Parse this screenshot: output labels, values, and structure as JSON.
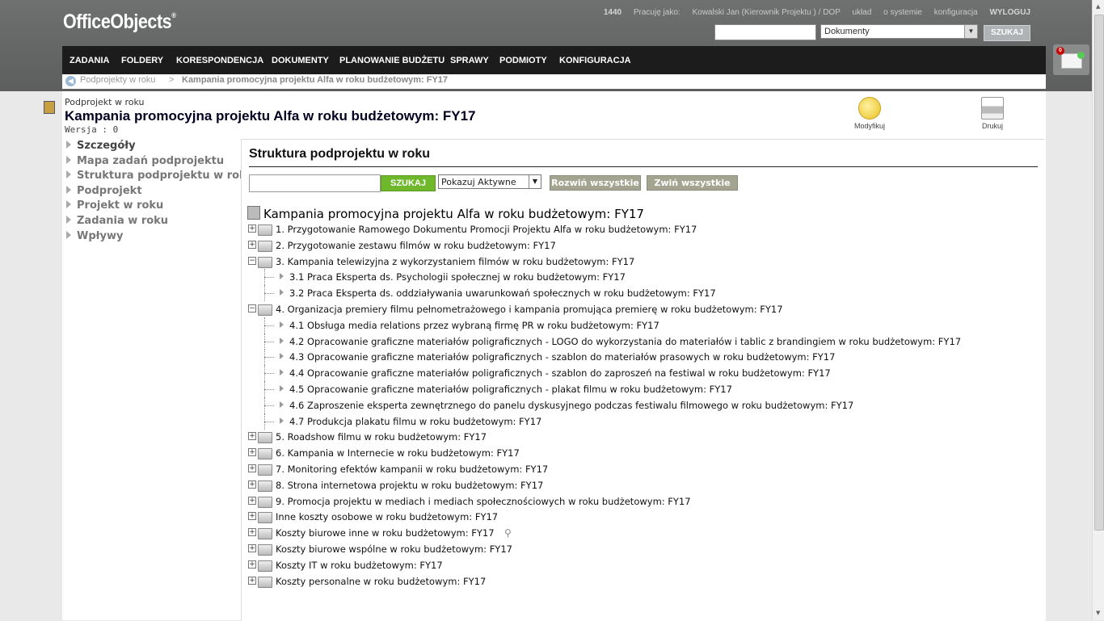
{
  "brand": {
    "name": "OfficeObjects",
    "mark": "®"
  },
  "userbar": {
    "id": "1440",
    "working_as_label": "Pracuję jako:",
    "user": "Kowalski Jan (Kierownik Projektu ) / DOP",
    "layout": "układ",
    "about": "o systemie",
    "config": "konfiguracja",
    "logout": "WYLOGUJ"
  },
  "topsearch": {
    "value": "",
    "scope": "Dokumenty",
    "button": "SZUKAJ"
  },
  "nav": [
    "ZADANIA",
    "FOLDERY",
    "KORESPONDENCJA",
    "DOKUMENTY",
    "PLANOWANIE BUDŻETU",
    "SPRAWY",
    "PODMIOTY",
    "KONFIGURACJA"
  ],
  "breadcrumb": {
    "parent": "Podprojekty w roku",
    "separator": ">",
    "current": "Kampania promocyjna projektu Alfa w roku budżetowym: FY17"
  },
  "mail": {
    "count": "0"
  },
  "page": {
    "type": "Podprojekt w roku",
    "title": "Kampania promocyjna projektu Alfa w roku budżetowym: FY17",
    "version": "Wersja : 0"
  },
  "actions": {
    "edit": "Modyfikuj",
    "print": "Drukuj"
  },
  "sidebar": [
    "Szczegóły",
    "Mapa zadań podprojektu",
    "Struktura podprojektu w roku",
    "Podprojekt",
    "Projekt w roku",
    "Zadania w roku",
    "Wpływy"
  ],
  "panel": {
    "title": "Struktura podprojektu w roku",
    "search_value": "",
    "search_button": "SZUKAJ",
    "filter": "Pokazuj Aktywne",
    "expand_all": "Rozwiń wszystkie",
    "collapse_all": "Zwiń wszystkie",
    "root": "Kampania promocyjna projektu Alfa w roku budżetowym: FY17",
    "rows": [
      {
        "level": 1,
        "label": "1. Przygotowanie Ramowego Dokumentu Promocji Projektu Alfa w roku budżetowym: FY17",
        "pm": "+"
      },
      {
        "level": 1,
        "label": "2. Przygotowanie zestawu filmów w roku budżetowym: FY17",
        "pm": "+"
      },
      {
        "level": 1,
        "label": "3. Kampania telewizyjna z wykorzystaniem filmów w roku budżetowym: FY17",
        "pm": "−"
      },
      {
        "level": 2,
        "label": "3.1 Praca Eksperta ds. Psychologii społecznej w roku budżetowym: FY17"
      },
      {
        "level": 2,
        "label": "3.2 Praca Eksperta ds. oddziaływania uwarunkowań społecznych w roku budżetowym: FY17"
      },
      {
        "level": 1,
        "label": "4. Organizacja premiery filmu pełnometrażowego i kampania promująca premierę w roku budżetowym: FY17",
        "pm": "−"
      },
      {
        "level": 2,
        "label": "4.1 Obsługa media relations przez wybraną firmę PR w roku budżetowym: FY17"
      },
      {
        "level": 2,
        "label": "4.2 Opracowanie graficzne materiałów poligraficznych - LOGO do wykorzystania do materiałów i tablic z brandingiem w roku budżetowym: FY17"
      },
      {
        "level": 2,
        "label": "4.3 Opracowanie graficzne materiałów poligraficznych - szablon do materiałów prasowych w roku budżetowym: FY17"
      },
      {
        "level": 2,
        "label": "4.4 Opracowanie graficzne materiałów poligraficznych - szablon do zaproszeń na festiwal w roku budżetowym: FY17"
      },
      {
        "level": 2,
        "label": "4.5 Opracowanie graficzne materiałów poligraficznych - plakat filmu w roku budżetowym: FY17"
      },
      {
        "level": 2,
        "label": "4.6 Zaproszenie eksperta zewnętrznego do panelu dyskusyjnego podczas festiwalu filmowego w roku budżetowym: FY17"
      },
      {
        "level": 2,
        "label": "4.7 Produkcja plakatu filmu w roku budżetowym: FY17"
      },
      {
        "level": 1,
        "label": "5. Roadshow filmu w roku budżetowym: FY17",
        "pm": "+"
      },
      {
        "level": 1,
        "label": "6. Kampania w Internecie w roku budżetowym: FY17",
        "pm": "+"
      },
      {
        "level": 1,
        "label": "7. Monitoring efektów kampanii w roku budżetowym: FY17",
        "pm": "+"
      },
      {
        "level": 1,
        "label": "8. Strona internetowa projektu w roku budżetowym: FY17",
        "pm": "+"
      },
      {
        "level": 1,
        "label": "9. Promocja projektu w mediach i mediach społecznościowych w roku budżetowym: FY17",
        "pm": "+"
      },
      {
        "level": 1,
        "label": "Inne koszty osobowe w roku budżetowym: FY17",
        "pm": "+"
      },
      {
        "level": 1,
        "label": "Koszty biurowe inne w roku budżetowym: FY17",
        "pm": "+",
        "search_icon": true
      },
      {
        "level": 1,
        "label": "Koszty biurowe wspólne w roku budżetowym: FY17",
        "pm": "+"
      },
      {
        "level": 1,
        "label": "Koszty IT w roku budżetowym: FY17",
        "pm": "+"
      },
      {
        "level": 1,
        "label": "Koszty personalne w roku budżetowym: FY17",
        "pm": "+"
      }
    ]
  }
}
